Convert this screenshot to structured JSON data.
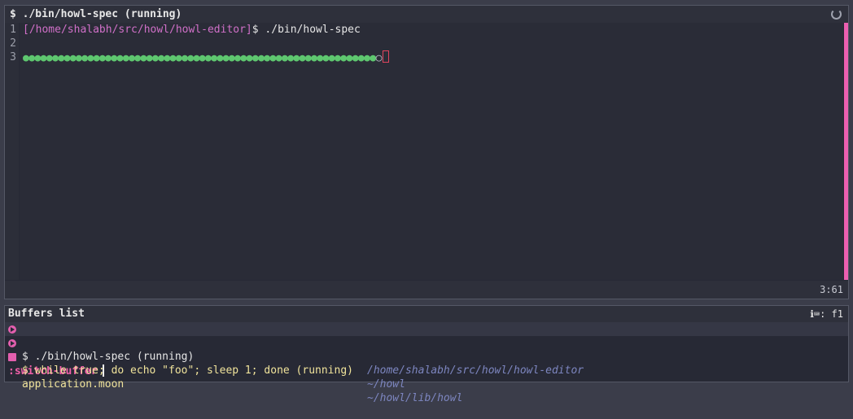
{
  "top_pane": {
    "title": "$ ./bin/howl-spec (running)",
    "line_numbers": [
      "1",
      "2",
      "3"
    ],
    "line1": {
      "path": "[/home/shalabh/src/howl/howl-editor]",
      "dollar": "$ ",
      "command": "./bin/howl-spec"
    },
    "line3": {
      "dots": "●●●●●●●●●●●●●●●●●●●●●●●●●●●●●●●●●●●●●●●●●●●●●●●●●●●●●●●●●●●●",
      "pending": "○"
    },
    "status": "3:61",
    "colors": {
      "pass": "#5ec76f",
      "prompt_path": "#d070c8",
      "marker": "#ec5fb0"
    }
  },
  "bottom_pane": {
    "title": "Buffers list",
    "info": "ℹ⌨: f1",
    "buffers": [
      {
        "icon": "process-icon",
        "name": "$ ./bin/howl-spec (running)",
        "dir": "/home/shalabh/src/howl/howl-editor"
      },
      {
        "icon": "process-icon",
        "name": "$ while true; do echo \"foo\"; sleep 1; done (running)",
        "dir": "~/howl"
      },
      {
        "icon": "file-icon",
        "name": "application.moon",
        "dir": "~/howl/lib/howl"
      }
    ],
    "command_label": ":switch-buffer"
  }
}
